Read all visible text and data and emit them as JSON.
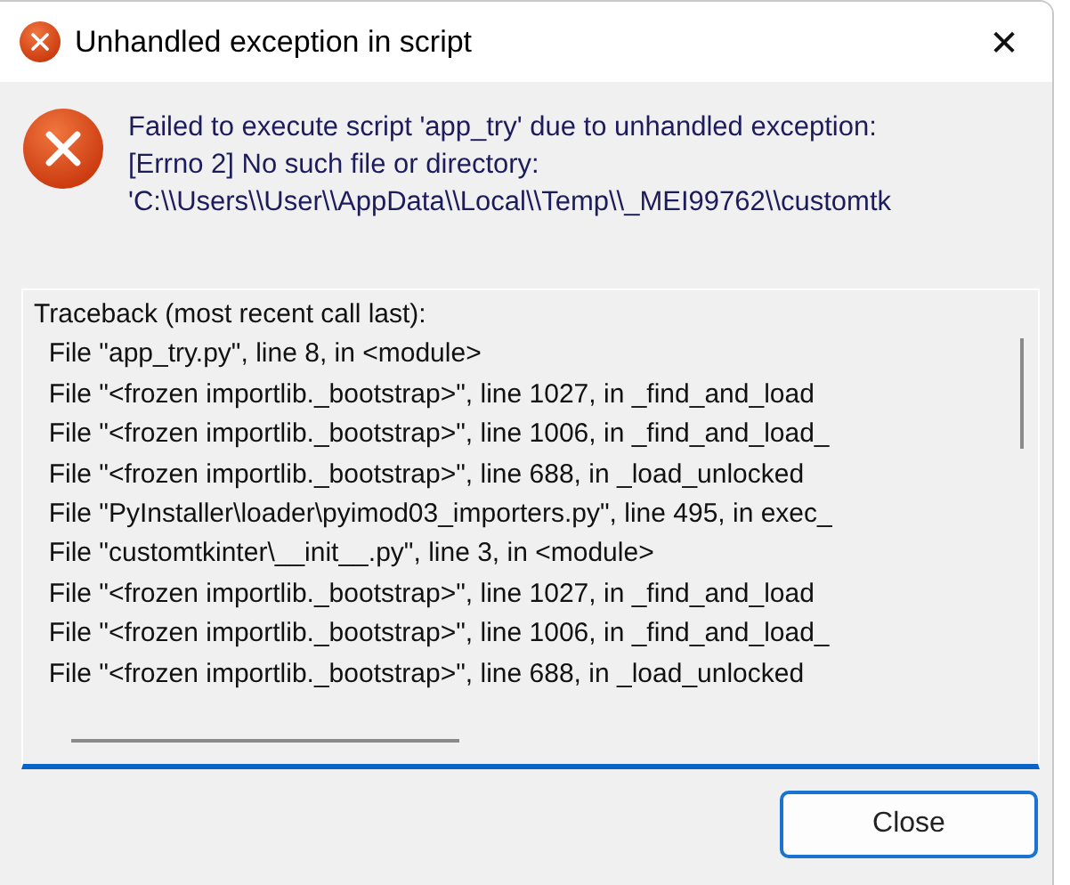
{
  "window": {
    "title": "Unhandled exception in script",
    "close_glyph": "✕"
  },
  "message": [
    "Failed to execute script 'app_try' due to unhandled exception:",
    "[Errno 2] No such file or directory:",
    "'C:\\\\Users\\\\User\\\\AppData\\\\Local\\\\Temp\\\\_MEI99762\\\\customtk"
  ],
  "traceback": [
    "Traceback (most recent call last):",
    "  File \"app_try.py\", line 8, in <module>",
    "  File \"<frozen importlib._bootstrap>\", line 1027, in _find_and_load",
    "  File \"<frozen importlib._bootstrap>\", line 1006, in _find_and_load_",
    "  File \"<frozen importlib._bootstrap>\", line 688, in _load_unlocked",
    "  File \"PyInstaller\\loader\\pyimod03_importers.py\", line 495, in exec_",
    "  File \"customtkinter\\__init__.py\", line 3, in <module>",
    "  File \"<frozen importlib._bootstrap>\", line 1027, in _find_and_load",
    "  File \"<frozen importlib._bootstrap>\", line 1006, in _find_and_load_",
    "  File \"<frozen importlib._bootstrap>\", line 688, in _load_unlocked"
  ],
  "buttons": [
    {
      "label": "Close",
      "default": true
    }
  ]
}
